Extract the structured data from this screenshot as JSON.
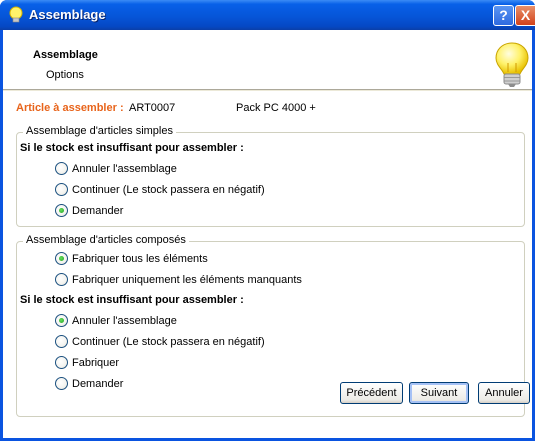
{
  "window": {
    "title": "Assemblage",
    "help_button": "?",
    "close_button": "X"
  },
  "header": {
    "title": "Assemblage",
    "subtitle": "Options"
  },
  "article": {
    "label": "Article à assembler :",
    "code": "ART0007",
    "name": "Pack PC 4000 +"
  },
  "group_simple": {
    "legend": "Assemblage d'articles simples",
    "question": "Si le stock est insuffisant pour assembler :",
    "options": [
      {
        "label": "Annuler l'assemblage",
        "checked": false
      },
      {
        "label": "Continuer (Le stock passera en négatif)",
        "checked": false
      },
      {
        "label": "Demander",
        "checked": true
      }
    ]
  },
  "group_composed": {
    "legend": "Assemblage d'articles composés",
    "mode_options": [
      {
        "label": "Fabriquer tous les éléments",
        "checked": true
      },
      {
        "label": "Fabriquer uniquement les éléments manquants",
        "checked": false
      }
    ],
    "question": "Si le stock est insuffisant pour assembler :",
    "options": [
      {
        "label": "Annuler l'assemblage",
        "checked": true
      },
      {
        "label": "Continuer (Le stock passera en négatif)",
        "checked": false
      },
      {
        "label": "Fabriquer",
        "checked": false
      },
      {
        "label": "Demander",
        "checked": false
      }
    ]
  },
  "buttons": {
    "previous": "Précédent",
    "next": "Suivant",
    "cancel": "Annuler"
  },
  "icons": {
    "title": "lightbulb-icon",
    "header": "lightbulb-icon"
  },
  "colors": {
    "accent_label": "#e8641b",
    "titlebar": "#0655d8"
  }
}
